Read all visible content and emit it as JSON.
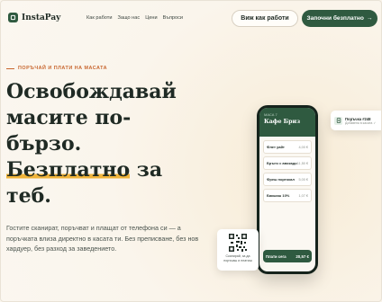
{
  "brand": {
    "name": "InstaPay",
    "accent": "#2f5a40",
    "highlight": "#f0b43a",
    "eyebrow_color": "#c8662e"
  },
  "nav": {
    "links": [
      "Как работи",
      "Защо нас",
      "Цени",
      "Въпроси"
    ],
    "secondary_cta": "Виж как работи",
    "primary_cta": "Започни безплатно",
    "primary_cta_icon": "→"
  },
  "hero": {
    "eyebrow": "ПОРЪЧАЙ И ПЛАТИ НА МАСАТА",
    "headline_lines": [
      "Освобождавай",
      "масите по-",
      "бързо."
    ],
    "headline_highlight": "Безплатно",
    "headline_rest": " за",
    "headline_last": "теб.",
    "subtext": "Гостите сканират, поръчват и плащат от телефона си — а поръчката влиза директно в касата ти. Без преписване, без нов хардуер, без разход за заведението."
  },
  "phone": {
    "table": "МАСА 7",
    "cafe": "Кафе Бриз",
    "items": [
      {
        "name": "Флет уайт",
        "price": "4,00 €"
      },
      {
        "name": "Брънч с авокадо",
        "price": "11,50 €"
      },
      {
        "name": "Фреш портокал",
        "price": "5,00 €"
      },
      {
        "name": "Бакшиш 10%",
        "price": "1,07 €"
      }
    ],
    "pay_label": "Плати сега",
    "pay_total": "20,57 €"
  },
  "toast": {
    "title": "Поръчка #248",
    "subtitle": "Добавена в касата ✓",
    "icon": "receipt-icon"
  },
  "qr": {
    "caption": "Сканирай, за да поръчаш и платиш",
    "icon": "qr-code-icon"
  }
}
